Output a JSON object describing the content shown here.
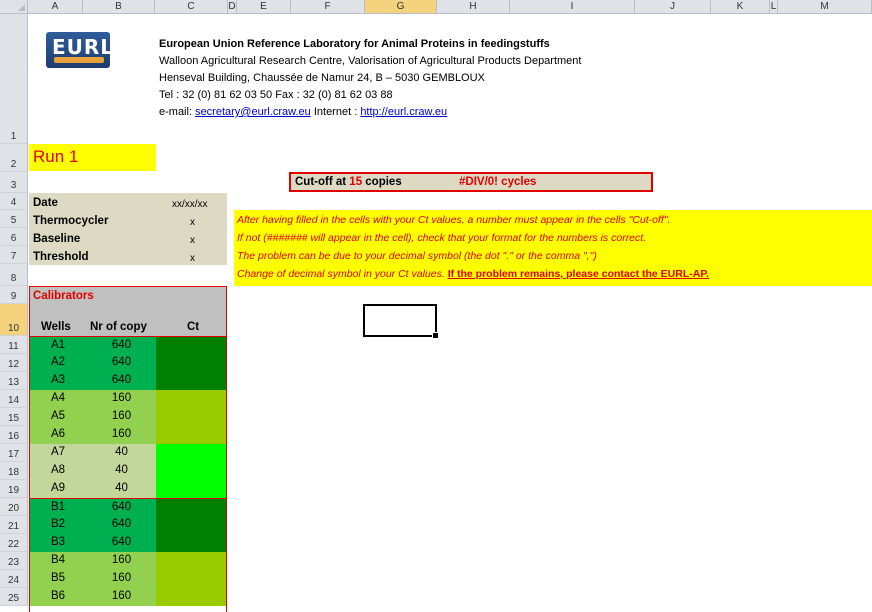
{
  "columns": [
    "A",
    "B",
    "C",
    "D",
    "E",
    "F",
    "G",
    "H",
    "I",
    "J",
    "K",
    "L",
    "M"
  ],
  "selected_column": "G",
  "rows": [
    "1",
    "2",
    "3",
    "4",
    "5",
    "6",
    "7",
    "8",
    "9",
    "10",
    "11",
    "12",
    "13",
    "14",
    "15",
    "16",
    "17",
    "18",
    "19",
    "20",
    "21",
    "22",
    "23",
    "24",
    "25"
  ],
  "selected_row": "10",
  "logo": {
    "text": "EURL"
  },
  "header": {
    "line1": "European Union Reference Laboratory for Animal Proteins in feedingstuffs",
    "line2": "Walloon Agricultural Research Centre, Valorisation of Agricultural Products Department",
    "line3": "Henseval Building, Chaussée de Namur 24,  B – 5030  GEMBLOUX",
    "line4": "Tel : 32 (0) 81 62 03 50    Fax : 32 (0) 81 62 03 88",
    "email_prefix": "e-mail: ",
    "email": "secretary@eurl.craw.eu",
    "internet_prefix": "  Internet : ",
    "internet": "http://eurl.craw.eu"
  },
  "run_label": "Run 1",
  "cutoff": {
    "prefix": "Cut-off at ",
    "copies": "15",
    "suffix": " copies",
    "result": "#DIV/0! cycles"
  },
  "meta": [
    {
      "label": "Date",
      "value": "xx/xx/xx"
    },
    {
      "label": "Thermocycler",
      "value": "x"
    },
    {
      "label": "Baseline",
      "value": "x"
    },
    {
      "label": "Threshold",
      "value": "x"
    }
  ],
  "notes": [
    "After having filled in the cells with your Ct values, a number must appear in the cells \"Cut-off\".",
    "If not (####### will appear in the cell), check that your format for the numbers is correct.",
    "The problem can be due to your decimal symbol (the dot \".\" or the comma \",\")",
    "Change of decimal symbol in your Ct values."
  ],
  "notes_last_bold": "If the problem remains, please contact the EURL-AP.",
  "calibrators": {
    "title": "Calibrators",
    "headers": {
      "wells": "Wells",
      "copies": "Nr of copy",
      "ct": "Ct"
    },
    "rows": [
      {
        "well": "A1",
        "copy": "640"
      },
      {
        "well": "A2",
        "copy": "640"
      },
      {
        "well": "A3",
        "copy": "640"
      },
      {
        "well": "A4",
        "copy": "160"
      },
      {
        "well": "A5",
        "copy": "160"
      },
      {
        "well": "A6",
        "copy": "160"
      },
      {
        "well": "A7",
        "copy": "40"
      },
      {
        "well": "A8",
        "copy": "40"
      },
      {
        "well": "A9",
        "copy": "40"
      },
      {
        "well": "B1",
        "copy": "640"
      },
      {
        "well": "B2",
        "copy": "640"
      },
      {
        "well": "B3",
        "copy": "640"
      },
      {
        "well": "B4",
        "copy": "160"
      },
      {
        "well": "B5",
        "copy": "160"
      },
      {
        "well": "B6",
        "copy": "160"
      }
    ]
  },
  "colors": {
    "run_bg": "#ffff00",
    "run_text": "#e00000",
    "meta_bg": "#ddd9c3",
    "notes_bg": "#ffff00",
    "cutoff_bg": "#ddd9c3",
    "cutoff_border": "#e00000",
    "calib_header_bg": "#c0c0c0",
    "group_640_bg": "#00b050",
    "group_640_ct": "#008000",
    "group_160_bg": "#92d050",
    "group_160_ct": "#99cc00",
    "group_40_bg": "#c4d79b",
    "group_40_ct": "#00ff00"
  }
}
